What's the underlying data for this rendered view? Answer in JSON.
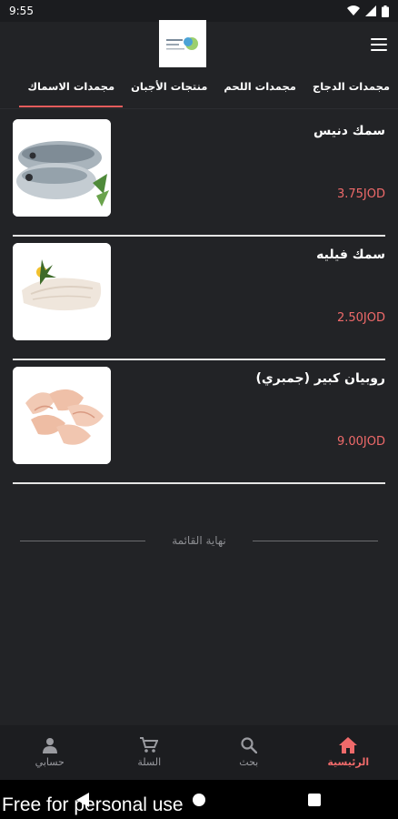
{
  "status_bar": {
    "time": "9:55"
  },
  "header": {
    "logo_icon": "store-logo",
    "menu_icon": "hamburger-menu-icon"
  },
  "tabs": [
    {
      "label": "مجمدات الدجاج",
      "active": false
    },
    {
      "label": "مجمدات اللحم",
      "active": false
    },
    {
      "label": "منتجات الأجبان",
      "active": false
    },
    {
      "label": "مجمدات الاسماك",
      "active": true
    }
  ],
  "products": [
    {
      "name": "سمك دنيس",
      "price": "3.75JOD",
      "image_icon": "sea-bream-fish"
    },
    {
      "name": "سمك فيليه",
      "price": "2.50JOD",
      "image_icon": "fish-fillet"
    },
    {
      "name": "روبيان كبير (جمبري)",
      "price": "9.00JOD",
      "image_icon": "shrimp"
    }
  ],
  "end_of_list": "نهاية القائمة",
  "bottom_nav": [
    {
      "label": "الرئيسية",
      "icon": "home-icon",
      "active": true
    },
    {
      "label": "بحث",
      "icon": "search-icon",
      "active": false
    },
    {
      "label": "السلة",
      "icon": "cart-icon",
      "active": false
    },
    {
      "label": "حسابي",
      "icon": "account-icon",
      "active": false
    }
  ],
  "watermark": "Free for personal use",
  "colors": {
    "accent": "#ef6a6a",
    "background": "#222326",
    "nav_background": "#1c1d20"
  }
}
